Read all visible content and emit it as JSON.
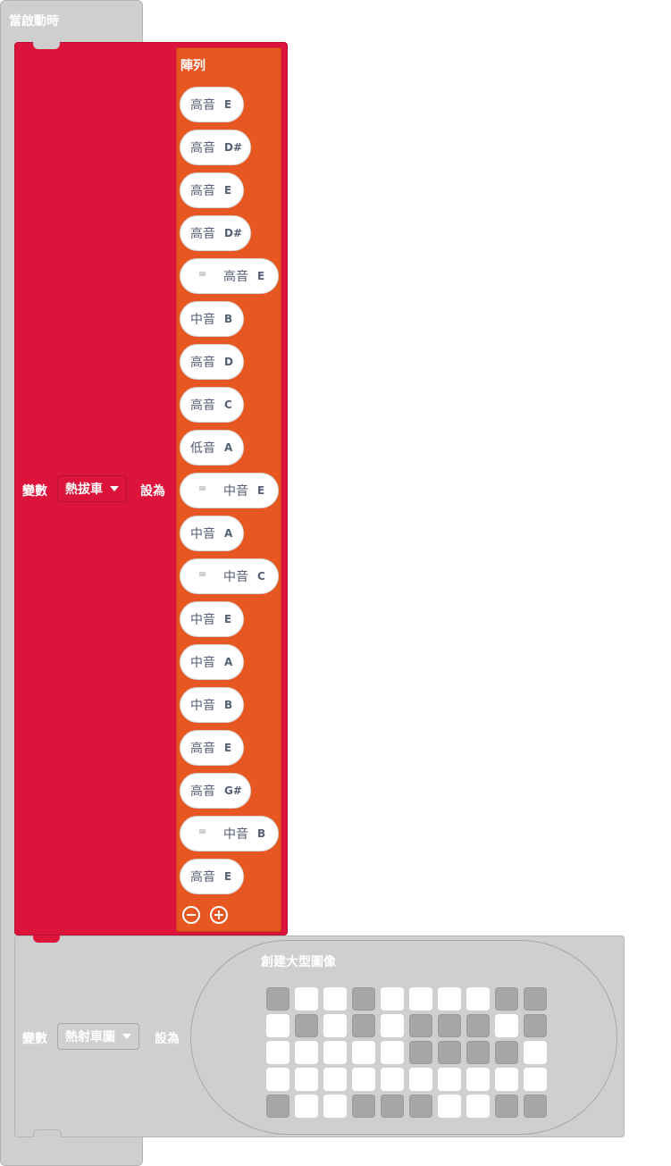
{
  "hat": {
    "label": "當啟動時"
  },
  "set1": {
    "var_label": "變數",
    "var_name": "熱拔車",
    "to_label": "設為",
    "array": {
      "title": "陣列",
      "notes": [
        {
          "octave": "高音",
          "pitch": "E",
          "flag": false
        },
        {
          "octave": "高音",
          "pitch": "D#",
          "flag": false
        },
        {
          "octave": "高音",
          "pitch": "E",
          "flag": false
        },
        {
          "octave": "高音",
          "pitch": "D#",
          "flag": false
        },
        {
          "octave": "高音",
          "pitch": "E",
          "flag": true
        },
        {
          "octave": "中音",
          "pitch": "B",
          "flag": false
        },
        {
          "octave": "高音",
          "pitch": "D",
          "flag": false
        },
        {
          "octave": "高音",
          "pitch": "C",
          "flag": false
        },
        {
          "octave": "低音",
          "pitch": "A",
          "flag": false
        },
        {
          "octave": "中音",
          "pitch": "E",
          "flag": true
        },
        {
          "octave": "中音",
          "pitch": "A",
          "flag": false
        },
        {
          "octave": "中音",
          "pitch": "C",
          "flag": true
        },
        {
          "octave": "中音",
          "pitch": "E",
          "flag": false
        },
        {
          "octave": "中音",
          "pitch": "A",
          "flag": false
        },
        {
          "octave": "中音",
          "pitch": "B",
          "flag": false
        },
        {
          "octave": "高音",
          "pitch": "E",
          "flag": false
        },
        {
          "octave": "高音",
          "pitch": "G#",
          "flag": false
        },
        {
          "octave": "中音",
          "pitch": "B",
          "flag": true
        },
        {
          "octave": "高音",
          "pitch": "E",
          "flag": false
        }
      ]
    }
  },
  "set2": {
    "var_label": "變數",
    "var_name": "熱射車圖",
    "to_label": "設為",
    "image_title": "創建大型圖像",
    "led_rows": [
      [
        1,
        0,
        0,
        1,
        0,
        0,
        0,
        0,
        1,
        1
      ],
      [
        0,
        1,
        0,
        1,
        0,
        1,
        1,
        1,
        0,
        1
      ],
      [
        0,
        0,
        0,
        0,
        0,
        1,
        1,
        1,
        1,
        0
      ],
      [
        0,
        0,
        0,
        0,
        0,
        0,
        0,
        0,
        0,
        0
      ],
      [
        1,
        0,
        0,
        1,
        1,
        1,
        0,
        0,
        1,
        1
      ]
    ]
  },
  "colors": {
    "set_block": "#dc143c",
    "array_block": "#e65722",
    "inactive_block": "#cfcfcf",
    "led_on": "#a6a6a6",
    "led_off": "#ffffff"
  },
  "icons": {
    "remove": "minus-circle-icon",
    "add": "plus-circle-icon",
    "dropdown": "caret-down-icon"
  }
}
